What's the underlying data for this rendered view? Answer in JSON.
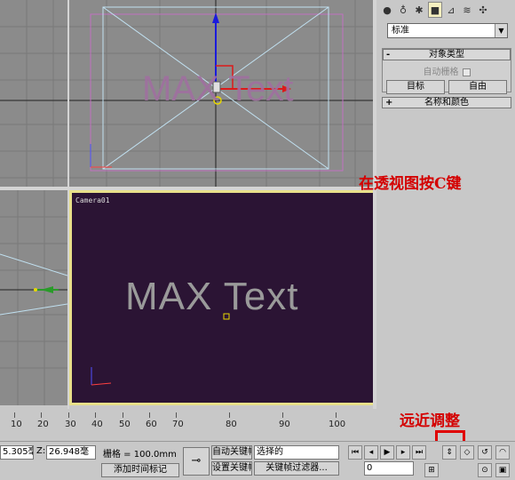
{
  "viewports": {
    "top": {
      "text": "MAX Text"
    },
    "camera": {
      "label": "Camera01",
      "text": "MAX Text"
    }
  },
  "panel": {
    "tabs": [
      {
        "icon": "sphere-icon"
      },
      {
        "icon": "shapes-icon"
      },
      {
        "icon": "light-icon"
      },
      {
        "icon": "camera-icon",
        "active": true
      },
      {
        "icon": "helpers-icon"
      },
      {
        "icon": "spacewarp-icon"
      },
      {
        "icon": "systems-icon"
      }
    ],
    "dropdown_value": "标准",
    "object_type": {
      "title": "对象类型",
      "toggle": "-",
      "autogrid_label": "自动栅格",
      "buttons": [
        "目标",
        "自由"
      ]
    },
    "name_color": {
      "title": "名称和颜色",
      "toggle": "+"
    }
  },
  "annotations": {
    "press_c": "在透视图按C键",
    "distance": "远近调整"
  },
  "timeline": {
    "ticks": [
      "10",
      "20",
      "30",
      "40",
      "50",
      "60",
      "70",
      "80",
      "90",
      "100"
    ]
  },
  "status": {
    "coord_y": "5.305毫",
    "coord_z_label": "Z:",
    "coord_z": "26.948毫",
    "grid": "栅格 = 100.0mm",
    "add_time_tag": "添加时间标记",
    "auto_key": "自动关键帧",
    "set_key": "设置关键帧",
    "selected": "选择的",
    "key_filters": "关键帧过滤器...",
    "frame": "0"
  },
  "colors": {
    "annotation": "#d40000",
    "camera_bg": "#2b1434",
    "active_border": "#e8e08a"
  }
}
